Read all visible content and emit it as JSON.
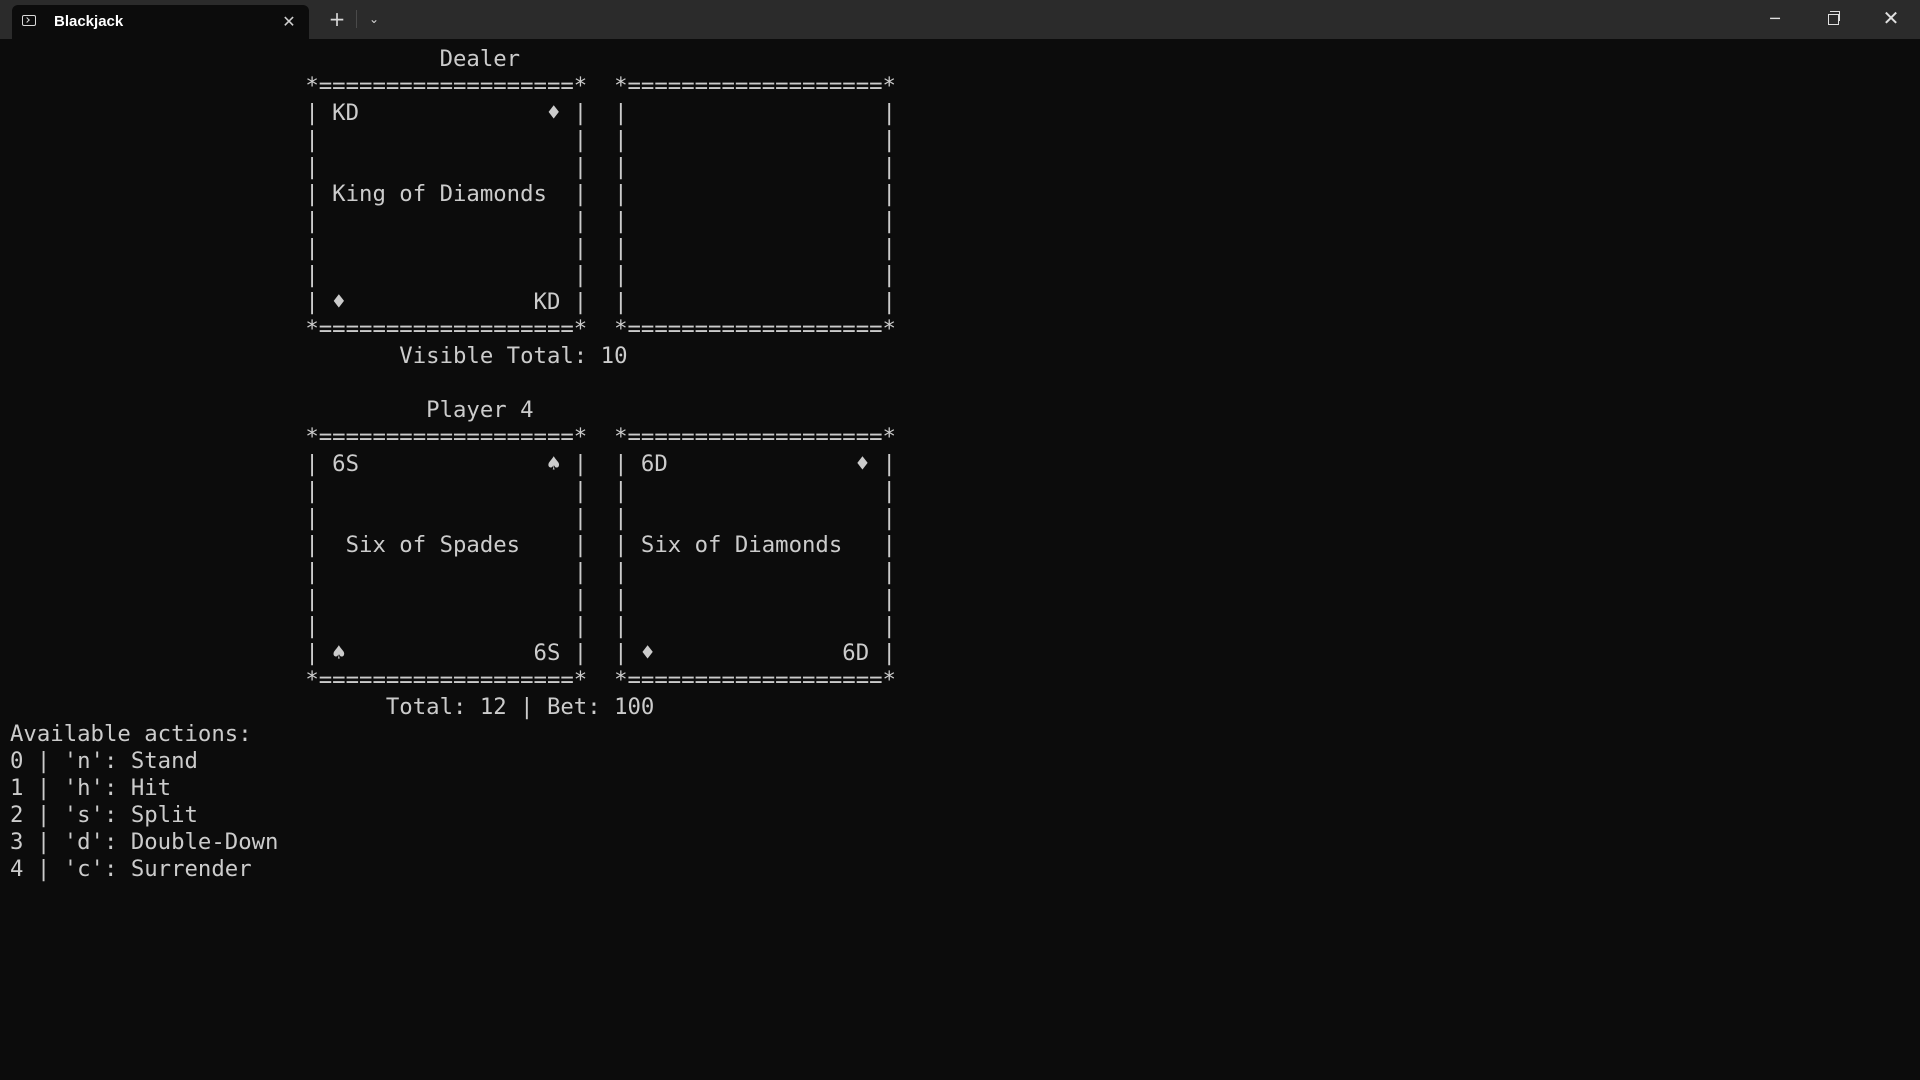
{
  "window": {
    "tab_title": "Blackjack",
    "tab_icon": "terminal-icon",
    "close_tab_symbol": "✕",
    "new_tab_symbol": "+",
    "dropdown_symbol": "⌄",
    "minimize_symbol": "─",
    "close_symbol": "✕"
  },
  "console": {
    "lines": [
      "                                Dealer",
      "                      *===================*  *===================*",
      "                      | KD              ♦ |  |                   |",
      "                      |                   |  |                   |",
      "                      |                   |  |                   |",
      "                      | King of Diamonds  |  |                   |",
      "                      |                   |  |                   |",
      "                      |                   |  |                   |",
      "                      |                   |  |                   |",
      "                      | ♦              KD |  |                   |",
      "                      *===================*  *===================*",
      "                             Visible Total: 10",
      "",
      "                               Player 4",
      "                      *===================*  *===================*",
      "                      | 6S              ♠ |  | 6D              ♦ |",
      "                      |                   |  |                   |",
      "                      |                   |  |                   |",
      "                      |  Six of Spades    |  | Six of Diamonds   |",
      "                      |                   |  |                   |",
      "                      |                   |  |                   |",
      "                      |                   |  |                   |",
      "                      | ♠              6S |  | ♦              6D |",
      "                      *===================*  *===================*",
      "                            Total: 12 | Bet: 100",
      "Available actions:",
      "0 | 'n': Stand",
      "1 | 'h': Hit",
      "2 | 's': Split",
      "3 | 'd': Double-Down",
      "4 | 'c': Surrender"
    ]
  }
}
